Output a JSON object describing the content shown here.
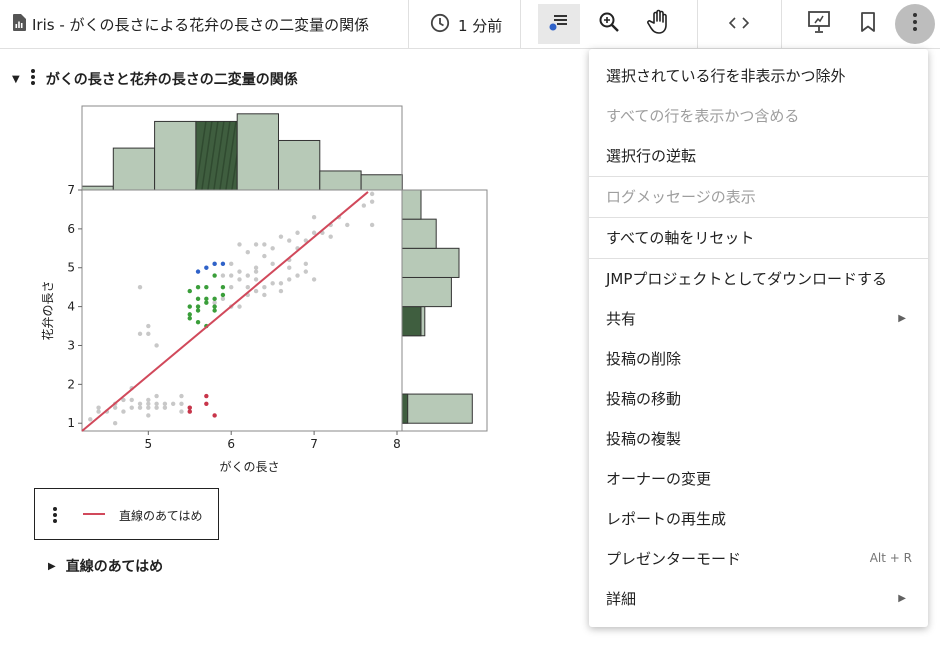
{
  "toolbar": {
    "title": "Iris - がくの長さによる花弁の長さの二変量の関係",
    "time": "1 分前",
    "icons": [
      "report-icon",
      "clock-icon",
      "selection-icon",
      "zoom-icon",
      "pan-hand-icon",
      "code-icon",
      "presentation-icon",
      "bookmark-icon",
      "more-vert-icon"
    ]
  },
  "report": {
    "section_title": "がくの長さと花弁の長さの二変量の関係",
    "sub_section_title": "直線のあてはめ",
    "legend_label": "直線のあてはめ"
  },
  "menu": {
    "items": [
      {
        "label": "選択されている行を非表示かつ除外",
        "disabled": false
      },
      {
        "label": "すべての行を表示かつ含める",
        "disabled": true
      },
      {
        "label": "選択行の逆転",
        "disabled": false
      },
      {
        "label": "ログメッセージの表示",
        "disabled": true
      },
      {
        "label": "すべての軸をリセット",
        "disabled": false
      },
      {
        "label": "JMPプロジェクトとしてダウンロードする",
        "disabled": false
      },
      {
        "label": "共有",
        "disabled": false,
        "submenu": true
      },
      {
        "label": "投稿の削除",
        "disabled": false
      },
      {
        "label": "投稿の移動",
        "disabled": false
      },
      {
        "label": "投稿の複製",
        "disabled": false
      },
      {
        "label": "オーナーの変更",
        "disabled": false
      },
      {
        "label": "レポートの再生成",
        "disabled": false
      },
      {
        "label": "プレゼンターモード",
        "disabled": false,
        "shortcut": "Alt + R"
      },
      {
        "label": "詳細",
        "disabled": false,
        "submenu": true
      }
    ]
  },
  "chart_data": {
    "type": "scatter",
    "xlabel": "がくの長さ",
    "ylabel": "花弁の長さ",
    "xlim": [
      4.2,
      8.0
    ],
    "ylim": [
      0.8,
      7.0
    ],
    "xticks": [
      "5",
      "6",
      "7",
      "8"
    ],
    "yticks": [
      "1",
      "2",
      "3",
      "4",
      "5",
      "6",
      "7"
    ],
    "fit_line": {
      "name": "直線のあてはめ",
      "color": "#d1495b",
      "x": [
        4.2,
        7.65
      ],
      "y": [
        0.73,
        6.95
      ]
    },
    "colors": {
      "unselected": "#c8c8c8",
      "green": "#3a9e3a",
      "blue": "#2f62c9",
      "red": "#c8354a",
      "hist_fill": "#b7c9b7",
      "hist_stroke": "#333333",
      "hist_selected": "#3f5e3f"
    },
    "points_gray": [
      [
        4.3,
        1.1
      ],
      [
        4.4,
        1.3
      ],
      [
        4.4,
        1.4
      ],
      [
        4.5,
        1.3
      ],
      [
        4.6,
        1.4
      ],
      [
        4.6,
        1.5
      ],
      [
        4.7,
        1.3
      ],
      [
        4.7,
        1.6
      ],
      [
        4.8,
        1.4
      ],
      [
        4.8,
        1.6
      ],
      [
        4.8,
        1.9
      ],
      [
        4.9,
        1.4
      ],
      [
        4.9,
        1.5
      ],
      [
        5.0,
        1.2
      ],
      [
        5.0,
        1.4
      ],
      [
        5.0,
        1.5
      ],
      [
        5.0,
        1.6
      ],
      [
        5.1,
        1.4
      ],
      [
        5.1,
        1.5
      ],
      [
        5.1,
        1.7
      ],
      [
        5.2,
        1.4
      ],
      [
        5.2,
        1.5
      ],
      [
        5.3,
        1.5
      ],
      [
        5.4,
        1.3
      ],
      [
        5.4,
        1.5
      ],
      [
        5.4,
        1.7
      ],
      [
        5.5,
        1.3
      ],
      [
        5.5,
        1.4
      ],
      [
        4.6,
        1.0
      ],
      [
        4.9,
        3.3
      ],
      [
        5.0,
        3.3
      ],
      [
        5.0,
        3.5
      ],
      [
        4.9,
        4.5
      ],
      [
        5.1,
        3.0
      ],
      [
        6.0,
        4.5
      ],
      [
        6.1,
        4.7
      ],
      [
        6.2,
        4.5
      ],
      [
        6.3,
        4.7
      ],
      [
        6.4,
        4.5
      ],
      [
        6.5,
        4.6
      ],
      [
        6.6,
        4.4
      ],
      [
        6.7,
        4.7
      ],
      [
        6.8,
        4.8
      ],
      [
        6.9,
        4.9
      ],
      [
        6.0,
        5.1
      ],
      [
        6.1,
        5.6
      ],
      [
        6.2,
        5.4
      ],
      [
        6.3,
        5.6
      ],
      [
        6.4,
        5.3
      ],
      [
        6.5,
        5.5
      ],
      [
        6.7,
        5.7
      ],
      [
        6.9,
        5.7
      ],
      [
        7.0,
        5.9
      ],
      [
        7.1,
        5.9
      ],
      [
        7.2,
        6.1
      ],
      [
        7.3,
        6.3
      ],
      [
        7.4,
        6.1
      ],
      [
        7.6,
        6.6
      ],
      [
        7.7,
        6.7
      ],
      [
        7.7,
        6.9
      ],
      [
        6.8,
        5.5
      ],
      [
        6.3,
        4.9
      ],
      [
        6.4,
        5.6
      ],
      [
        6.5,
        5.1
      ],
      [
        6.7,
        5.0
      ],
      [
        6.1,
        4.0
      ],
      [
        6.0,
        4.0
      ],
      [
        6.2,
        4.3
      ],
      [
        6.3,
        4.4
      ],
      [
        5.9,
        4.2
      ],
      [
        6.1,
        4.9
      ],
      [
        6.4,
        4.3
      ],
      [
        6.3,
        5.0
      ],
      [
        7.0,
        4.7
      ],
      [
        6.6,
        4.6
      ],
      [
        6.7,
        5.2
      ],
      [
        7.2,
        5.8
      ],
      [
        6.0,
        4.8
      ],
      [
        6.2,
        4.8
      ],
      [
        5.9,
        4.8
      ],
      [
        6.6,
        5.8
      ],
      [
        7.0,
        6.3
      ],
      [
        7.7,
        6.1
      ],
      [
        6.8,
        5.9
      ],
      [
        6.9,
        5.1
      ],
      [
        5.8,
        4.1
      ],
      [
        5.8,
        5.1
      ]
    ],
    "points_green": [
      [
        5.5,
        3.7
      ],
      [
        5.5,
        4.0
      ],
      [
        5.5,
        4.4
      ],
      [
        5.6,
        3.6
      ],
      [
        5.6,
        3.9
      ],
      [
        5.6,
        4.2
      ],
      [
        5.6,
        4.5
      ],
      [
        5.7,
        3.5
      ],
      [
        5.7,
        4.1
      ],
      [
        5.7,
        4.5
      ],
      [
        5.8,
        3.9
      ],
      [
        5.8,
        4.0
      ],
      [
        5.8,
        4.2
      ],
      [
        5.9,
        4.5
      ],
      [
        5.5,
        3.8
      ],
      [
        5.6,
        4.0
      ],
      [
        5.7,
        4.2
      ],
      [
        5.8,
        4.8
      ],
      [
        5.9,
        4.3
      ]
    ],
    "points_blue": [
      [
        5.6,
        4.9
      ],
      [
        5.7,
        5.0
      ],
      [
        5.8,
        5.1
      ],
      [
        5.9,
        5.1
      ]
    ],
    "points_red": [
      [
        5.5,
        1.3
      ],
      [
        5.5,
        1.4
      ],
      [
        5.7,
        1.5
      ],
      [
        5.7,
        1.7
      ],
      [
        5.8,
        1.2
      ]
    ],
    "hist_x": {
      "counts": [
        2,
        22,
        36,
        36,
        40,
        26,
        10,
        8
      ],
      "selected_bin": 3
    },
    "hist_y": {
      "counts": [
        37,
        0,
        0,
        12,
        26,
        30,
        18,
        10
      ],
      "selected": [
        3,
        7,
        10,
        10,
        0,
        0,
        0,
        0
      ]
    }
  }
}
